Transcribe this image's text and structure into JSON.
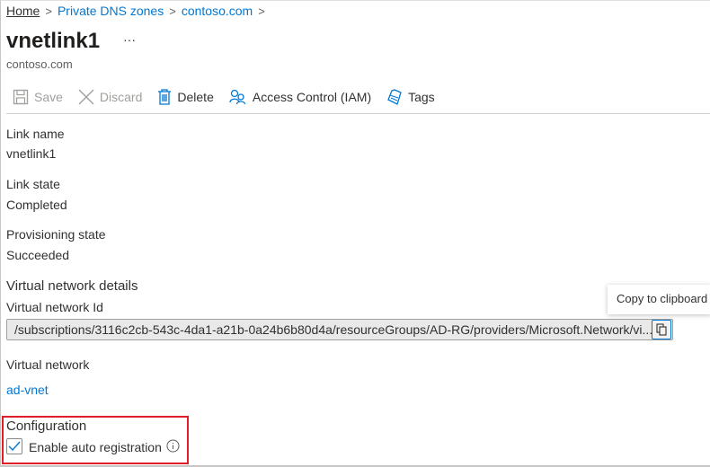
{
  "breadcrumb": [
    "Home",
    "Private DNS zones",
    "contoso.com"
  ],
  "title": "vnetlink1",
  "more": "···",
  "subtitle": "contoso.com",
  "toolbar": {
    "save": "Save",
    "discard": "Discard",
    "delete": "Delete",
    "iam": "Access Control (IAM)",
    "tags": "Tags"
  },
  "fields": {
    "link_name_label": "Link name",
    "link_name": "vnetlink1",
    "link_state_label": "Link state",
    "link_state": "Completed",
    "prov_label": "Provisioning state",
    "prov": "Succeeded",
    "vnet_details": "Virtual network details",
    "vnet_id_label": "Virtual network Id",
    "vnet_id": "/subscriptions/3116c2cb-543c-4da1-a21b-0a24b6b80d4a/resourceGroups/AD-RG/providers/Microsoft.Network/vi...",
    "vnet_label": "Virtual network",
    "vnet": "ad-vnet"
  },
  "tooltip": "Copy to clipboard",
  "config": {
    "heading": "Configuration",
    "auto_reg": "Enable auto registration",
    "checked": true
  },
  "colors": {
    "accent": "#0078d4",
    "highlight": "#e01e28"
  }
}
